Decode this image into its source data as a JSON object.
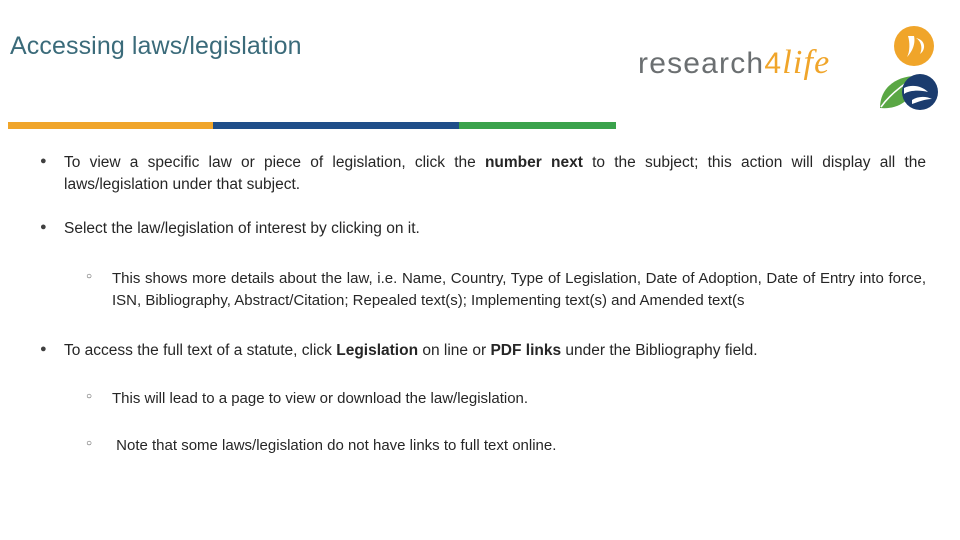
{
  "slide": {
    "title": "Accessing laws/legislation",
    "rule_colors": [
      "#f0a52a",
      "#1f4e89",
      "#3aa24b"
    ]
  },
  "logo": {
    "word_research": "research",
    "word_four": "4",
    "word_life": "life",
    "colors": {
      "text_gray": "#6b6f71",
      "orange": "#f0a52a",
      "green": "#5aa744",
      "navy": "#1b3c6e"
    }
  },
  "content": {
    "bullets": [
      {
        "level": 1,
        "parts": [
          {
            "text": "To view a specific law or piece of legislation, click the ",
            "bold": false
          },
          {
            "text": "number next",
            "bold": true
          },
          {
            "text": " to the subject; this action will display all the laws/legislation under that subject.",
            "bold": false
          }
        ]
      },
      {
        "level": 1,
        "parts": [
          {
            "text": "Select the law/legislation of interest by clicking on it.",
            "bold": false
          }
        ]
      },
      {
        "level": 2,
        "parts": [
          {
            "text": "This shows more details about the law, i.e. Name, Country, Type of Legislation, Date of Adoption, Date of Entry into force, ISN, Bibliography, Abstract/Citation; Repealed text(s); Implementing text(s) and Amended text(s",
            "bold": false
          }
        ]
      },
      {
        "level": 1,
        "parts": [
          {
            "text": "To access the full text of a statute, click ",
            "bold": false
          },
          {
            "text": "Legislation",
            "bold": true
          },
          {
            "text": " on line or ",
            "bold": false
          },
          {
            "text": "PDF links",
            "bold": true
          },
          {
            "text": " under the Bibliography field.",
            "bold": false
          }
        ]
      },
      {
        "level": 2,
        "parts": [
          {
            "text": "This will lead to a page to view or download the law/legislation.",
            "bold": false
          }
        ]
      },
      {
        "level": 2,
        "parts": [
          {
            "text": " Note that some laws/legislation do not have links to full text online.",
            "bold": false
          }
        ]
      }
    ]
  }
}
